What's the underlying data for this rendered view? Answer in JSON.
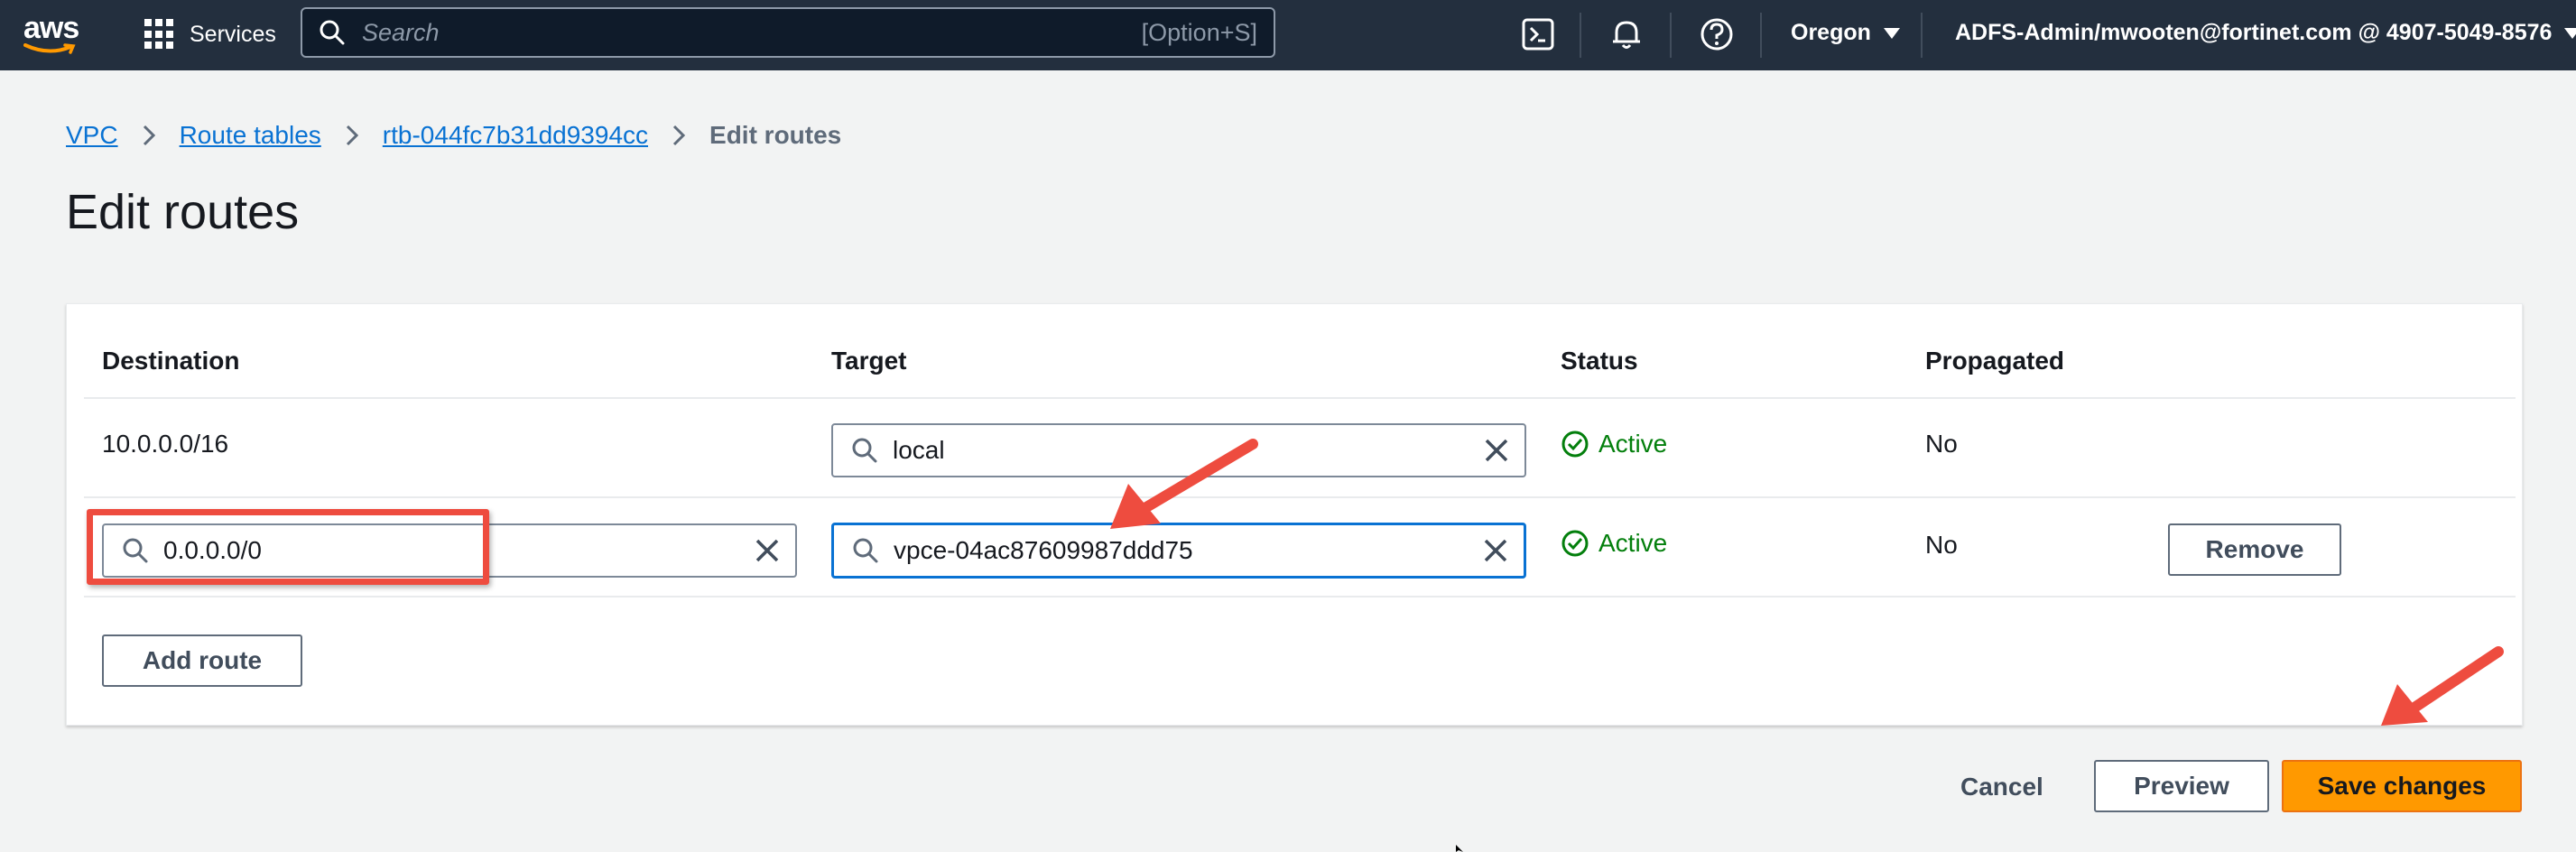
{
  "topnav": {
    "logo_text": "aws",
    "services_label": "Services",
    "search_placeholder": "Search",
    "search_shortcut": "[Option+S]",
    "icons": [
      "cloudshell-icon",
      "bell-icon",
      "help-icon"
    ],
    "region": "Oregon",
    "account": "ADFS-Admin/mwooten@fortinet.com @ 4907-5049-8576"
  },
  "breadcrumb": {
    "items": [
      "VPC",
      "Route tables",
      "rtb-044fc7b31dd9394cc"
    ],
    "current": "Edit routes"
  },
  "page": {
    "title": "Edit routes"
  },
  "table": {
    "headers": {
      "destination": "Destination",
      "target": "Target",
      "status": "Status",
      "propagated": "Propagated"
    },
    "rows": [
      {
        "destination": "10.0.0.0/16",
        "target": "local",
        "status": "Active",
        "propagated": "No"
      },
      {
        "destination": "0.0.0.0/0",
        "target": "vpce-04ac87609987ddd75",
        "status": "Active",
        "propagated": "No",
        "action": "Remove"
      }
    ],
    "add_route_label": "Add route"
  },
  "footer": {
    "cancel_label": "Cancel",
    "preview_label": "Preview",
    "save_label": "Save changes"
  },
  "colors": {
    "nav_bg": "#232f3e",
    "link": "#0972d3",
    "status_active": "#037f0c",
    "primary_button": "#ff9900",
    "annotation": "#ee4c3f"
  }
}
